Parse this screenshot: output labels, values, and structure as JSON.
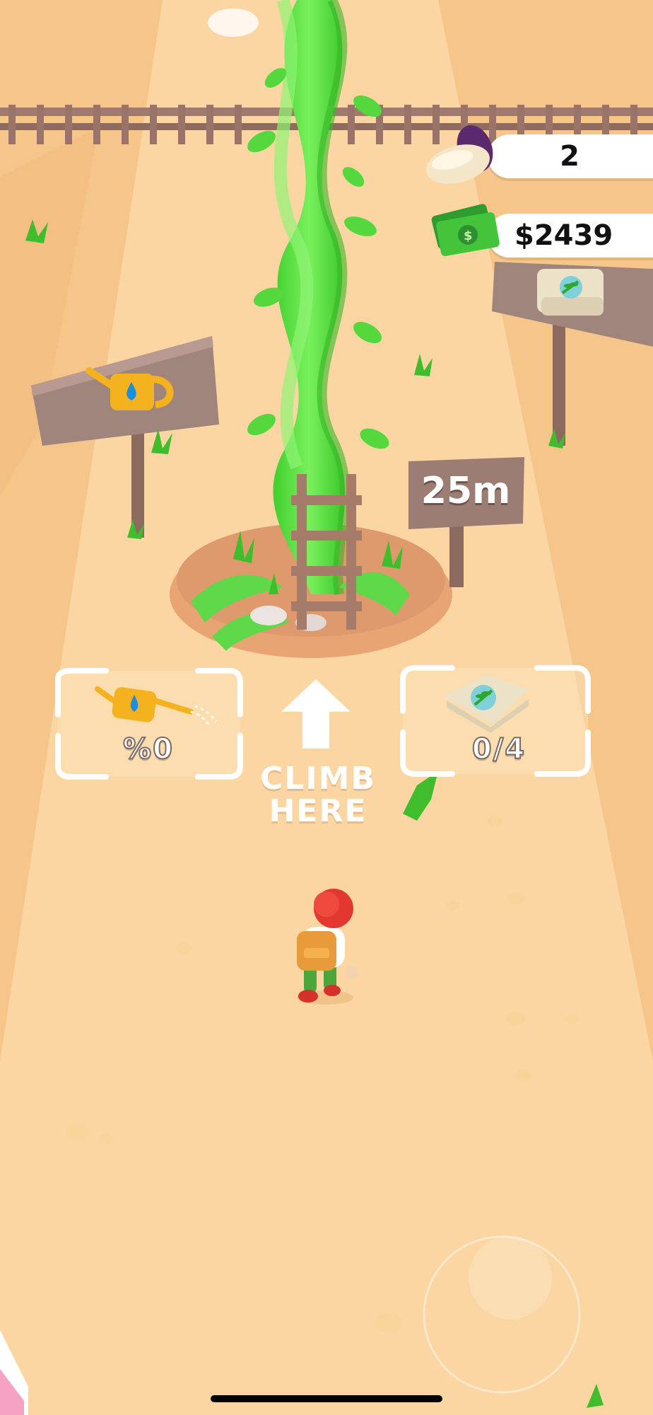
{
  "hud": {
    "beans_count": "2",
    "money": "$2439"
  },
  "zones": {
    "water_progress": "%0",
    "seed_progress": "0/4"
  },
  "climb": {
    "line1": "CLIMB",
    "line2": "HERE"
  },
  "height_sign": "25m",
  "icons": {
    "bean": "bean-icon",
    "money": "money-icon",
    "watering_can": "watering-can-icon",
    "seed_bag": "seed-bag-icon",
    "arrow": "arrow-up-icon",
    "joystick": "joystick"
  },
  "colors": {
    "sand": "#f7c98c",
    "path": "#fbd8a4",
    "beanstalk": "#4fdc3b",
    "wood": "#a07a6e",
    "bean_purple": "#5b2a6e"
  }
}
